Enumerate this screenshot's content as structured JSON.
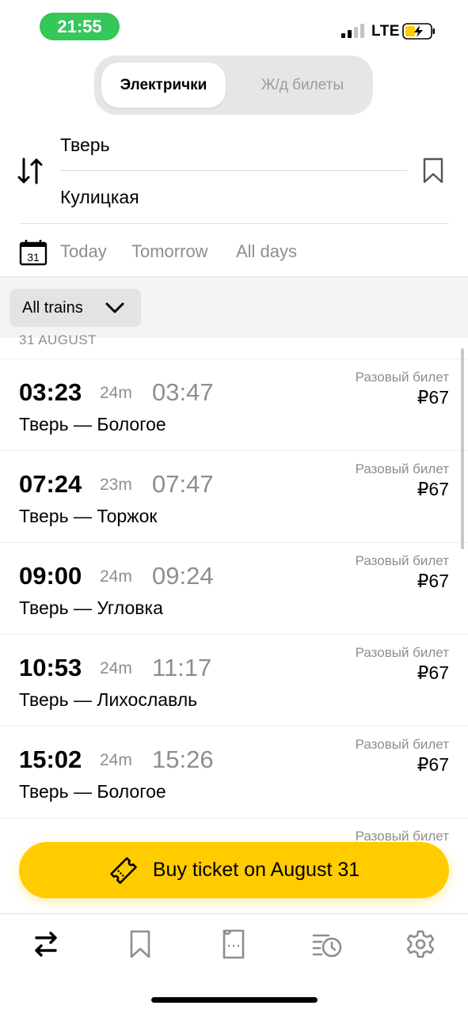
{
  "status_bar": {
    "time": "21:55",
    "network": "LTE"
  },
  "segments": {
    "active_label": "Электрички",
    "inactive_label": "Ж/д билеты"
  },
  "route": {
    "from": "Тверь",
    "to": "Кулицкая"
  },
  "dates": {
    "calendar_day": "31",
    "today": "Today",
    "tomorrow": "Tomorrow",
    "all_days": "All days"
  },
  "filter": {
    "label": "All trains"
  },
  "section_date": "31 AUGUST",
  "trains": [
    {
      "dep": "03:23",
      "dur": "24m",
      "arr": "03:47",
      "direction": "Тверь — Бологое",
      "ticket_type": "Разовый билет",
      "price": "₽67"
    },
    {
      "dep": "07:24",
      "dur": "23m",
      "arr": "07:47",
      "direction": "Тверь — Торжок",
      "ticket_type": "Разовый билет",
      "price": "₽67"
    },
    {
      "dep": "09:00",
      "dur": "24m",
      "arr": "09:24",
      "direction": "Тверь — Угловка",
      "ticket_type": "Разовый билет",
      "price": "₽67"
    },
    {
      "dep": "10:53",
      "dur": "24m",
      "arr": "11:17",
      "direction": "Тверь — Лихославль",
      "ticket_type": "Разовый билет",
      "price": "₽67"
    },
    {
      "dep": "15:02",
      "dur": "24m",
      "arr": "15:26",
      "direction": "Тверь — Бологое",
      "ticket_type": "Разовый билет",
      "price": "₽67"
    },
    {
      "dep": "",
      "dur": "",
      "arr": "",
      "direction": "",
      "ticket_type": "Разовый билет",
      "price": ""
    }
  ],
  "buy_button": {
    "label": "Buy ticket on August 31"
  },
  "colors": {
    "accent": "#ffcc00",
    "time_pill": "#34c759"
  },
  "icons": {
    "swap": "swap-icon",
    "bookmark": "bookmark-icon",
    "calendar": "calendar-icon",
    "chevron": "chevron-down-icon",
    "ticket": "ticket-icon",
    "tabs": [
      "routes-icon",
      "bookmark-icon",
      "ticket-icon",
      "history-icon",
      "gear-icon"
    ]
  }
}
